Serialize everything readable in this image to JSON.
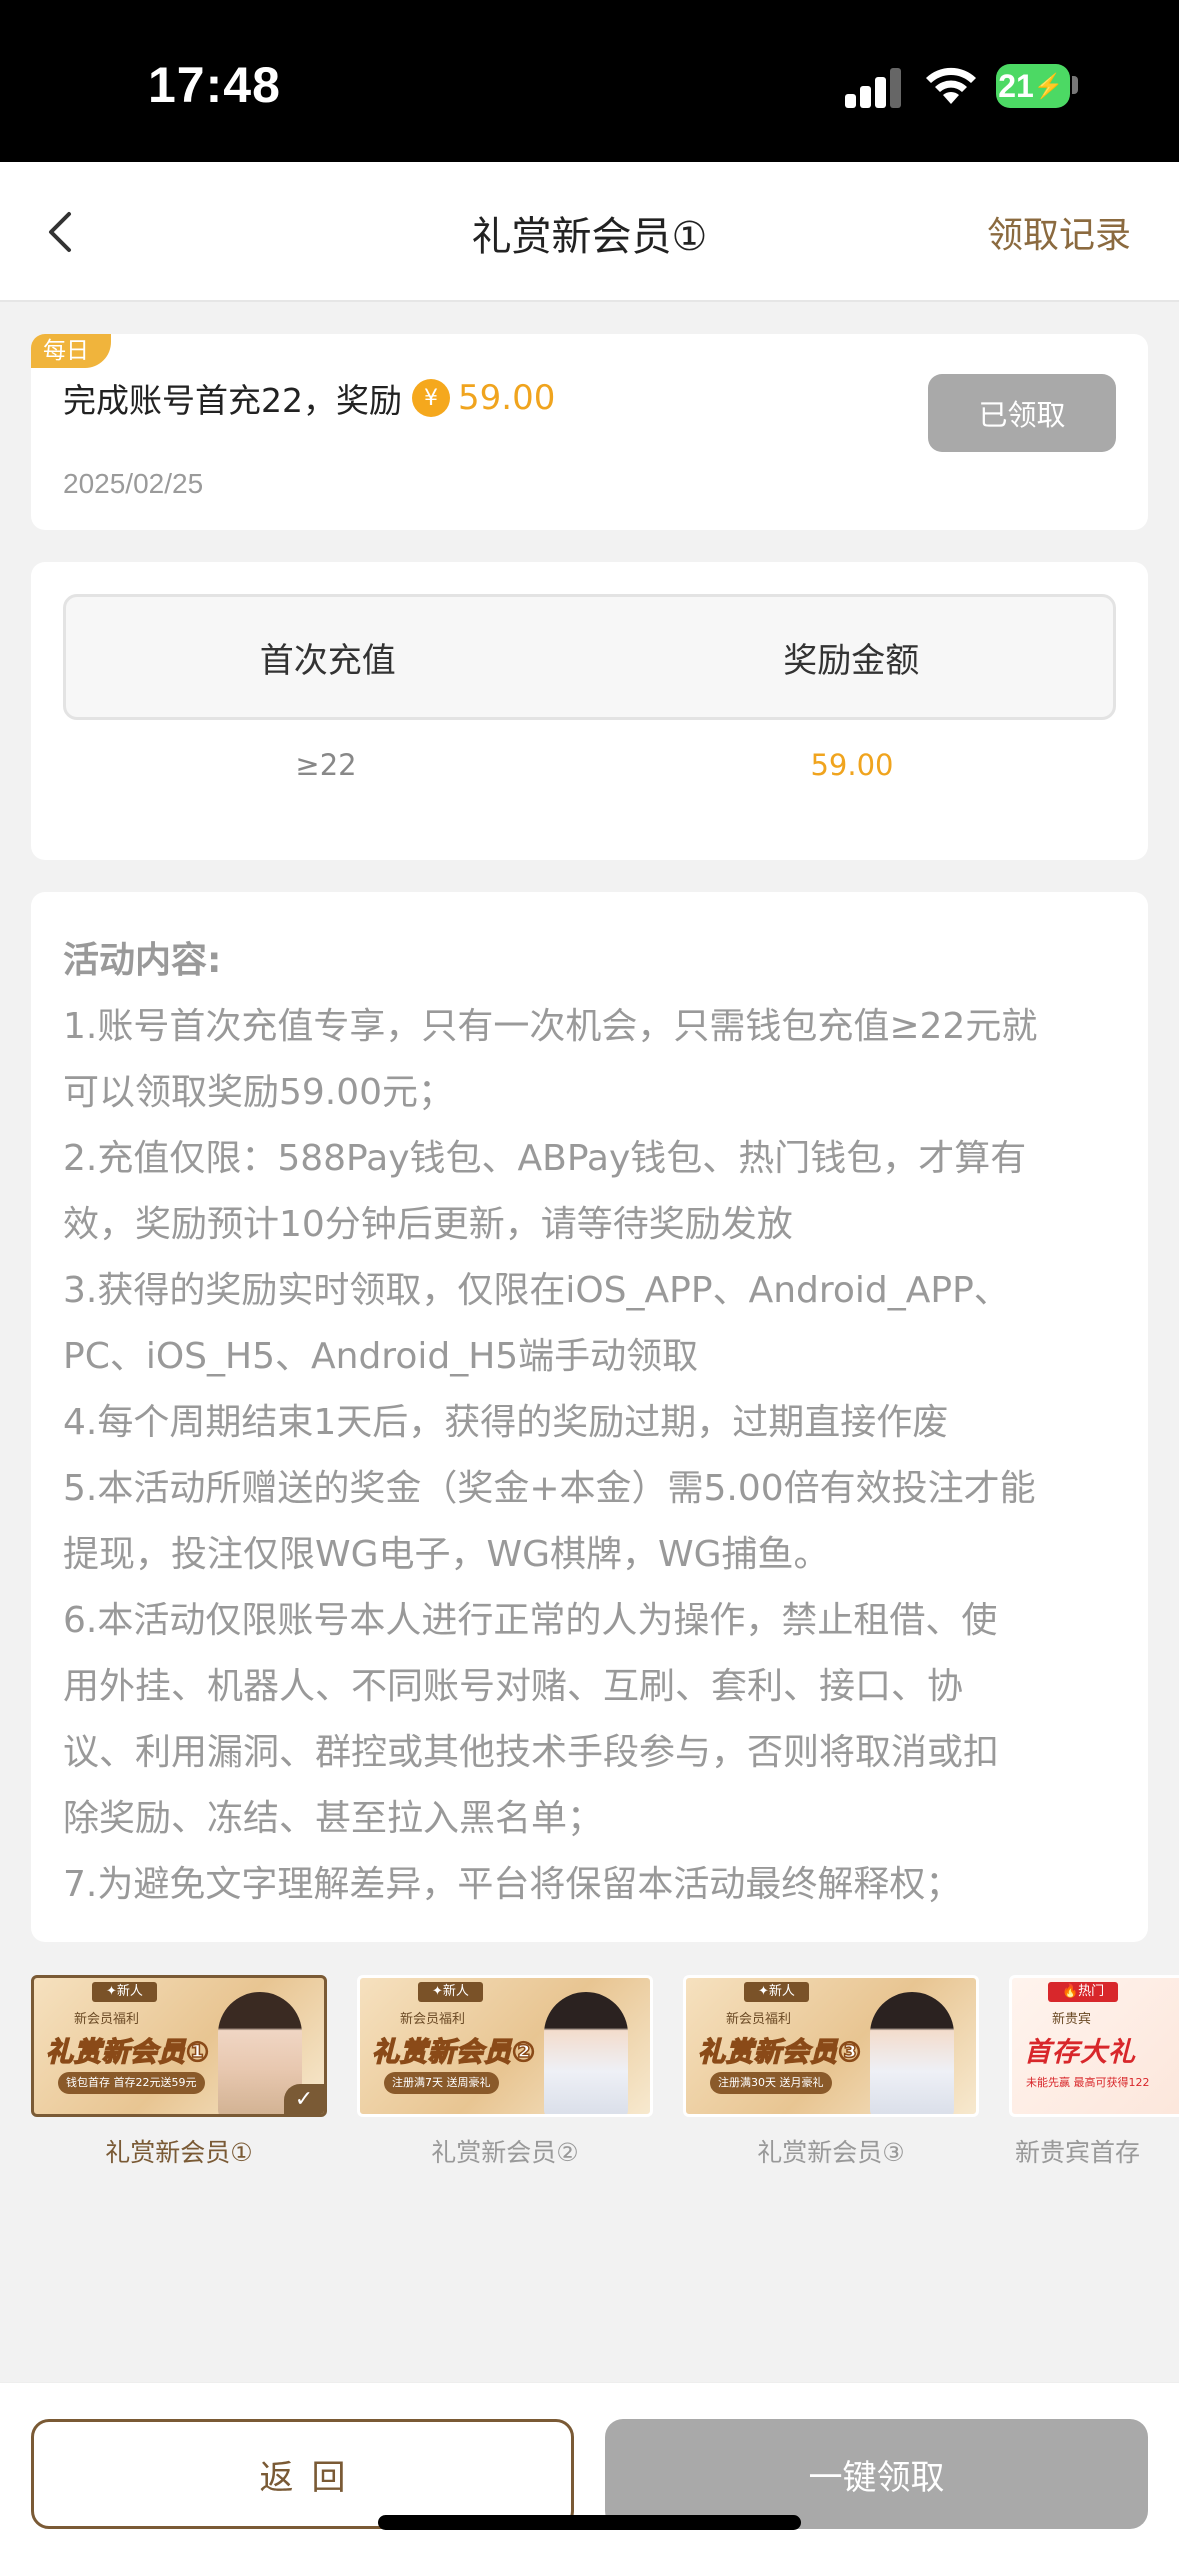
{
  "status_bar": {
    "time": "17:48",
    "battery": "21"
  },
  "nav": {
    "title": "礼赏新会员①",
    "records_label": "领取记录"
  },
  "task": {
    "tag": "每日",
    "text": "完成账号首充22，奖励",
    "coin_symbol": "¥",
    "amount": "59.00",
    "date": "2025/02/25",
    "button_label": "已领取"
  },
  "table": {
    "headers": [
      "首次充值",
      "奖励金额"
    ],
    "rows": [
      [
        "≥22",
        "59.00"
      ]
    ]
  },
  "rules": {
    "title": "活动内容:",
    "lines": [
      "1.账号首次充值专享，只有一次机会，只需钱包充值≥22元就",
      "可以领取奖励59.00元；",
      "2.充值仅限：588Pay钱包、ABPay钱包、热门钱包，才算有",
      "效，奖励预计10分钟后更新，请等待奖励发放",
      "3.获得的奖励实时领取，仅限在iOS_APP、Android_APP、",
      "PC、iOS_H5、Android_H5端手动领取",
      "4.每个周期结束1天后，获得的奖励过期，过期直接作废",
      "5.本活动所赠送的奖金（奖金+本金）需5.00倍有效投注才能",
      "提现，投注仅限WG电子，WG棋牌，WG捕鱼。",
      "6.本活动仅限账号本人进行正常的人为操作，禁止租借、使",
      "用外挂、机器人、不同账号对赌、互刷、套利、接口、协",
      "议、利用漏洞、群控或其他技术手段参与，否则将取消或扣",
      "除奖励、冻结、甚至拉入黑名单；",
      "7.为避免文字理解差异，平台将保留本活动最终解释权；"
    ]
  },
  "activities": [
    {
      "badge": "✦新人",
      "subtitle": "新会员福利",
      "title": "礼赏新会员①",
      "note": "钱包首存 首存22元送59元",
      "label": "礼赏新会员①"
    },
    {
      "badge": "✦新人",
      "subtitle": "新会员福利",
      "title": "礼赏新会员②",
      "note": "注册满7天 送周豪礼",
      "label": "礼赏新会员②"
    },
    {
      "badge": "✦新人",
      "subtitle": "新会员福利",
      "title": "礼赏新会员③",
      "note": "注册满30天 送月豪礼",
      "label": "礼赏新会员③"
    },
    {
      "badge": "🔥热门",
      "subtitle": "新贵宾",
      "title": "首存大礼",
      "note": "未能先赢 最高可获得122",
      "label": "新贵宾首存"
    }
  ],
  "bottom": {
    "return_label": "返回",
    "claim_all_label": "一键领取"
  },
  "colors": {
    "accent_gold": "#7a5a35",
    "reward_orange": "#f0a41e",
    "disabled_gray": "#a9a9a9"
  }
}
